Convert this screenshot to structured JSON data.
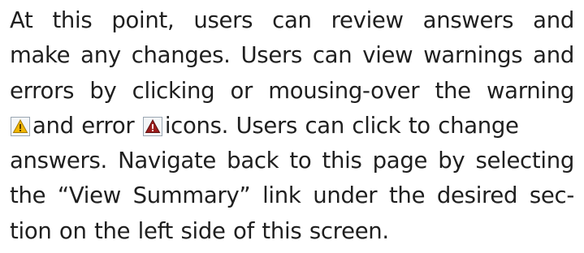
{
  "paragraph": {
    "line1": "At this point, users can review answers and",
    "line2": "make any changes. Users can view warnings and",
    "line3": "errors by clicking or mousing-over the warning",
    "line4_after_warning_icon": "and error",
    "line4_after_error_icon": "icons. Users can click to change",
    "line5": "answers. Navigate back to this page by selecting",
    "line6": "the “View Summary” link under the desired sec-",
    "line7": "tion on the left side of this screen."
  },
  "icons": {
    "warning": {
      "name": "warning-icon",
      "color": "#f2b705"
    },
    "error": {
      "name": "error-icon",
      "color": "#9b1c1c"
    }
  }
}
